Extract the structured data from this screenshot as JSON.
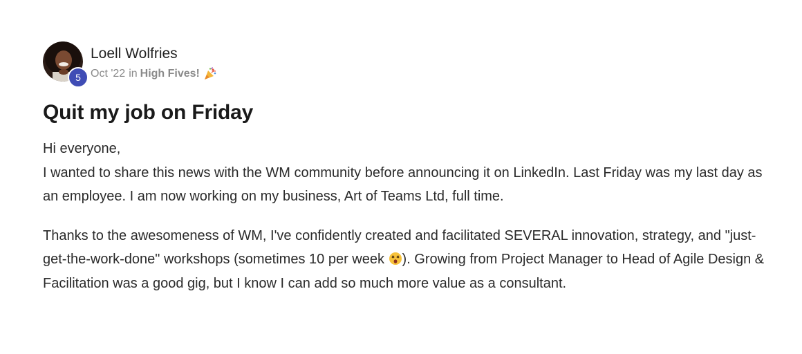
{
  "post": {
    "author": "Loell Wolfries",
    "level_badge": "5",
    "date": "Oct '22",
    "in_word": "in",
    "category": "High Fives!",
    "category_icon": "party-popper-icon",
    "title": "Quit my job on Friday",
    "greeting": "Hi everyone,",
    "paragraph1": "I wanted to share this news with the WM community before announcing it on LinkedIn. Last Friday was my last day as an employee. I am now working on my business, Art of Teams Ltd, full time.",
    "paragraph2_before_emoji": "Thanks to the awesomeness of WM, I've confidently created and facilitated SEVERAL innovation, strategy, and \"just-get-the-work-done\" workshops (sometimes 10 per week ",
    "paragraph2_emoji": "dizzy-face-emoji",
    "paragraph2_after_emoji": "). Growing from Project Manager to Head of Agile Design & Facilitation was a good gig, but I know I can add so much more value as a consultant."
  },
  "colors": {
    "badge": "#3f4cb5",
    "meta_text": "#8a8a8a",
    "title_text": "#1a1a1a",
    "body_text": "#2a2a2a"
  }
}
